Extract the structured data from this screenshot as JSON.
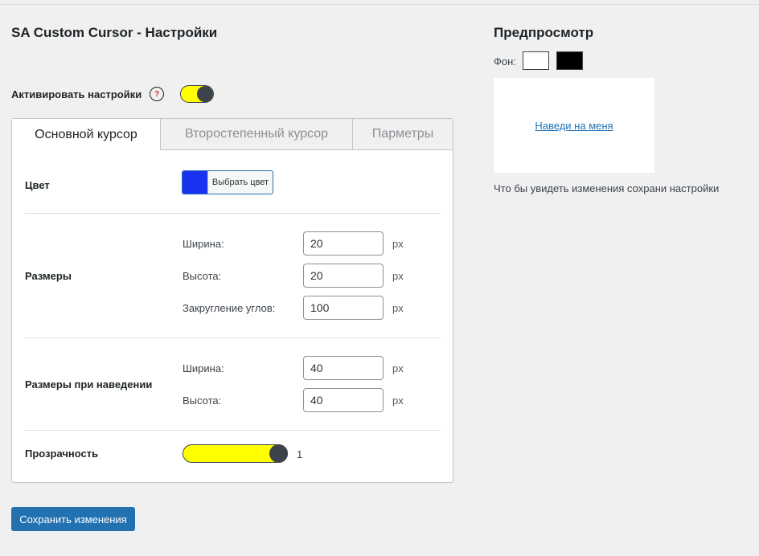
{
  "settings": {
    "title": "SA Custom Cursor - Настройки",
    "activate_label": "Активировать настройки",
    "help_glyph": "?",
    "activate_enabled": true
  },
  "tabs": [
    {
      "label": "Основной курсор",
      "active": true
    },
    {
      "label": "Второстепенный курсор",
      "active": false
    },
    {
      "label": "Парметры",
      "active": false
    }
  ],
  "color": {
    "label": "Цвет",
    "button_label": "Выбрать цвет",
    "value": "#1a33f0"
  },
  "sizes": {
    "label": "Размеры",
    "width_label": "Ширина:",
    "width_value": "20",
    "height_label": "Высота:",
    "height_value": "20",
    "radius_label": "Закругление углов:",
    "radius_value": "100",
    "unit": "px"
  },
  "hover_sizes": {
    "label": "Размеры при наведении",
    "width_label": "Ширина:",
    "width_value": "40",
    "height_label": "Высота:",
    "height_value": "40",
    "unit": "px"
  },
  "opacity": {
    "label": "Прозрачность",
    "value": "1"
  },
  "save_label": "Сохранить изменения",
  "preview": {
    "title": "Предпросмотр",
    "bg_label": "Фон:",
    "link_text": "Наведи на меня",
    "note": "Что бы увидеть изменения сохрани настройки"
  },
  "colors": {
    "accent": "#2271b1",
    "toggle_fill": "#ffff00",
    "knob": "#3c434a"
  }
}
